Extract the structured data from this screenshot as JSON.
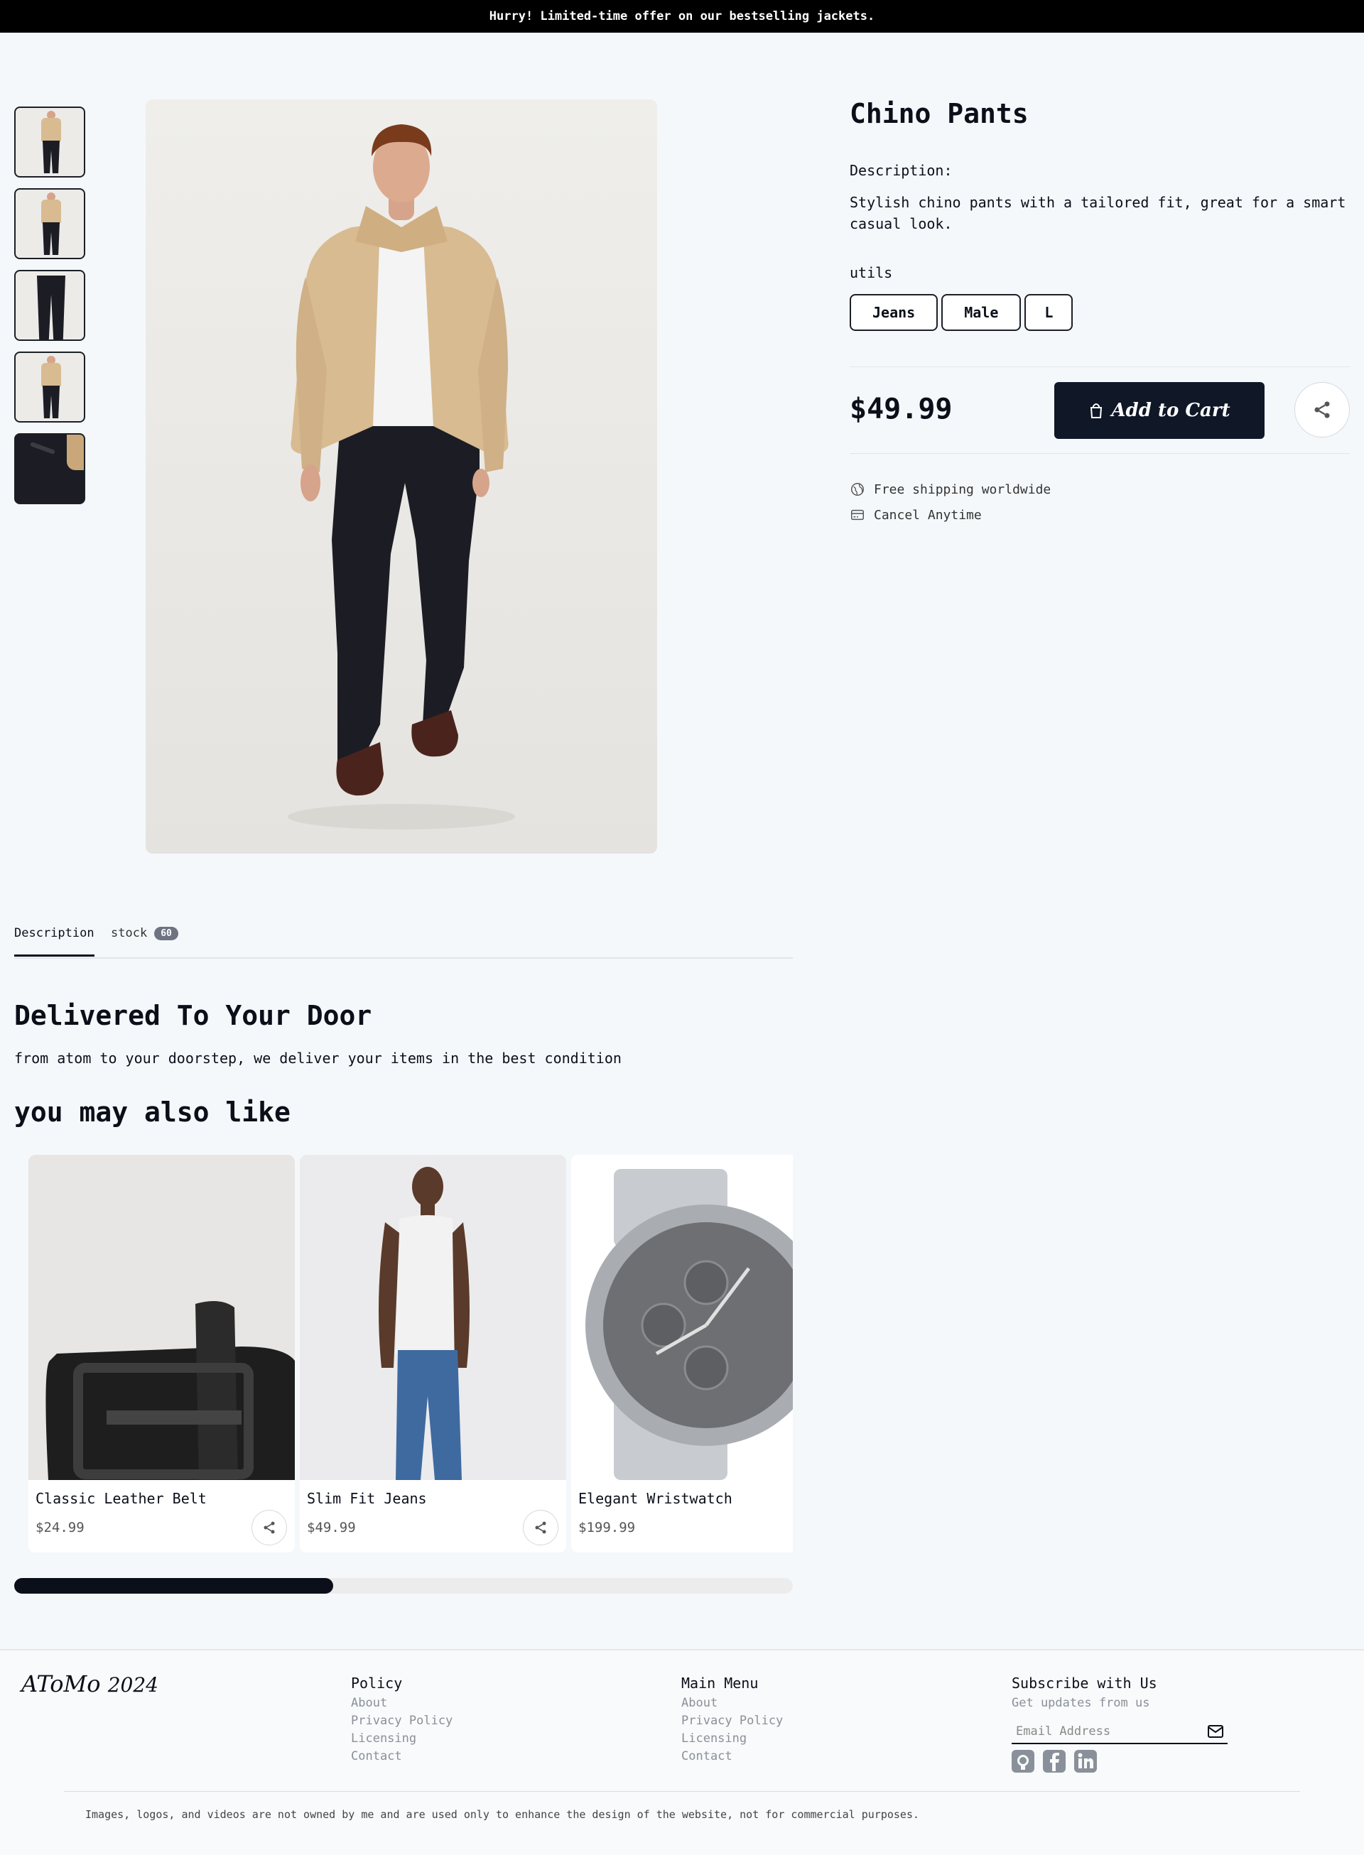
{
  "announcement": "Hurry! Limited-time offer on our bestselling jackets.",
  "product": {
    "title": "Chino Pants",
    "description_label": "Description:",
    "description": "Stylish chino pants with a tailored fit, great for a smart casual look.",
    "utils_label": "utils",
    "tags": [
      "Jeans",
      "Male",
      "L"
    ],
    "price": "$49.99",
    "add_to_cart": "Add to Cart",
    "features": [
      "Free shipping worldwide",
      "Cancel Anytime"
    ],
    "thumbnails": [
      "jacket-front",
      "jacket-side",
      "pants",
      "jacket-full",
      "pocket-detail"
    ]
  },
  "tabs": {
    "description": "Description",
    "stock": "stock",
    "stock_count": "60"
  },
  "delivery": {
    "title": "Delivered To Your Door",
    "text": "from atom to your doorstep, we deliver your items in the best condition"
  },
  "related": {
    "title": "you may also like",
    "items": [
      {
        "name": "Classic Leather Belt",
        "price": "$24.99"
      },
      {
        "name": "Slim Fit Jeans",
        "price": "$49.99"
      },
      {
        "name": "Elegant Wristwatch",
        "price": "$199.99"
      }
    ],
    "scroll_progress": 0.41
  },
  "footer": {
    "logo": "AToMo",
    "year": "2024",
    "policy": {
      "title": "Policy",
      "links": [
        "About",
        "Privacy Policy",
        "Licensing",
        "Contact"
      ]
    },
    "menu": {
      "title": "Main Menu",
      "links": [
        "About",
        "Privacy Policy",
        "Licensing",
        "Contact"
      ]
    },
    "subscribe": {
      "title": "Subscribe with Us",
      "subtitle": "Get updates from us",
      "placeholder": "Email Address"
    },
    "socials": [
      "github-icon",
      "facebook-icon",
      "linkedin-icon"
    ],
    "disclaimer": "Images, logos, and videos are not owned by me and are used only to enhance the design of the website, not for commercial purposes."
  },
  "colors": {
    "primary": "#101727",
    "background": "#f5f8fb",
    "muted": "#8a9099"
  }
}
